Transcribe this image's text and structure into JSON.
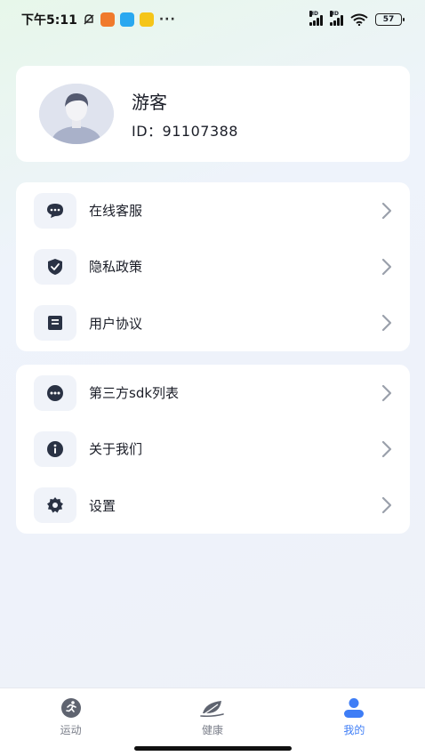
{
  "status_bar": {
    "time": "下午5:11",
    "dots": "···",
    "battery": "57"
  },
  "profile": {
    "name": "游客",
    "id": "ID：91107388"
  },
  "menu_group_1": [
    {
      "label": "在线客服",
      "icon": "chat-bubble-icon"
    },
    {
      "label": "隐私政策",
      "icon": "shield-check-icon"
    },
    {
      "label": "用户协议",
      "icon": "document-icon"
    }
  ],
  "menu_group_2": [
    {
      "label": "第三方sdk列表",
      "icon": "more-dots-icon"
    },
    {
      "label": "关于我们",
      "icon": "info-icon"
    },
    {
      "label": "设置",
      "icon": "gear-icon"
    }
  ],
  "tabs": [
    {
      "label": "运动",
      "icon": "running-icon",
      "active": false
    },
    {
      "label": "健康",
      "icon": "leaf-icon",
      "active": false
    },
    {
      "label": "我的",
      "icon": "person-icon",
      "active": true
    }
  ],
  "colors": {
    "accent": "#3e7df6",
    "icon_dark": "#2a3244",
    "chevron": "#9aa0ab"
  }
}
